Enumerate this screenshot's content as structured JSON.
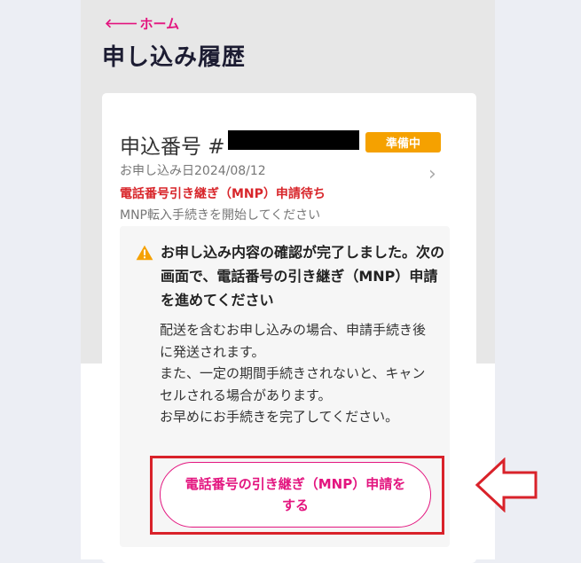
{
  "header": {
    "back_label": "ホーム",
    "page_title": "申し込み履歴"
  },
  "order": {
    "number_prefix": "申込番号 #",
    "status_badge": "準備中",
    "apply_date": "お申し込み日2024/08/12",
    "state_label": "電話番号引き継ぎ（MNP）申請待ち",
    "state_desc": "MNP転入手続きを開始してください"
  },
  "notice": {
    "title": "お申し込み内容の確認が完了しました。次の画面で、電話番号の引き継ぎ（MNP）申請を進めてください",
    "body": [
      "配送を含むお申し込みの場合、申請手続き後に発送されます。",
      "また、一定の期間手続きされないと、キャンセルされる場合があります。",
      "お早めにお手続きを完了してください。"
    ],
    "button_label": "電話番号の引き継ぎ（MNP）申請をする"
  },
  "colors": {
    "accent": "#e3157f",
    "badge": "#f5a100",
    "alert_text": "#d8262b",
    "annotation": "#d9222a",
    "warning_icon": "#f5a100"
  },
  "icons": {
    "back": "arrow-left-icon",
    "detail": "chevron-right-icon",
    "warning": "warning-triangle-icon",
    "annotation": "pointer-arrow-icon"
  }
}
